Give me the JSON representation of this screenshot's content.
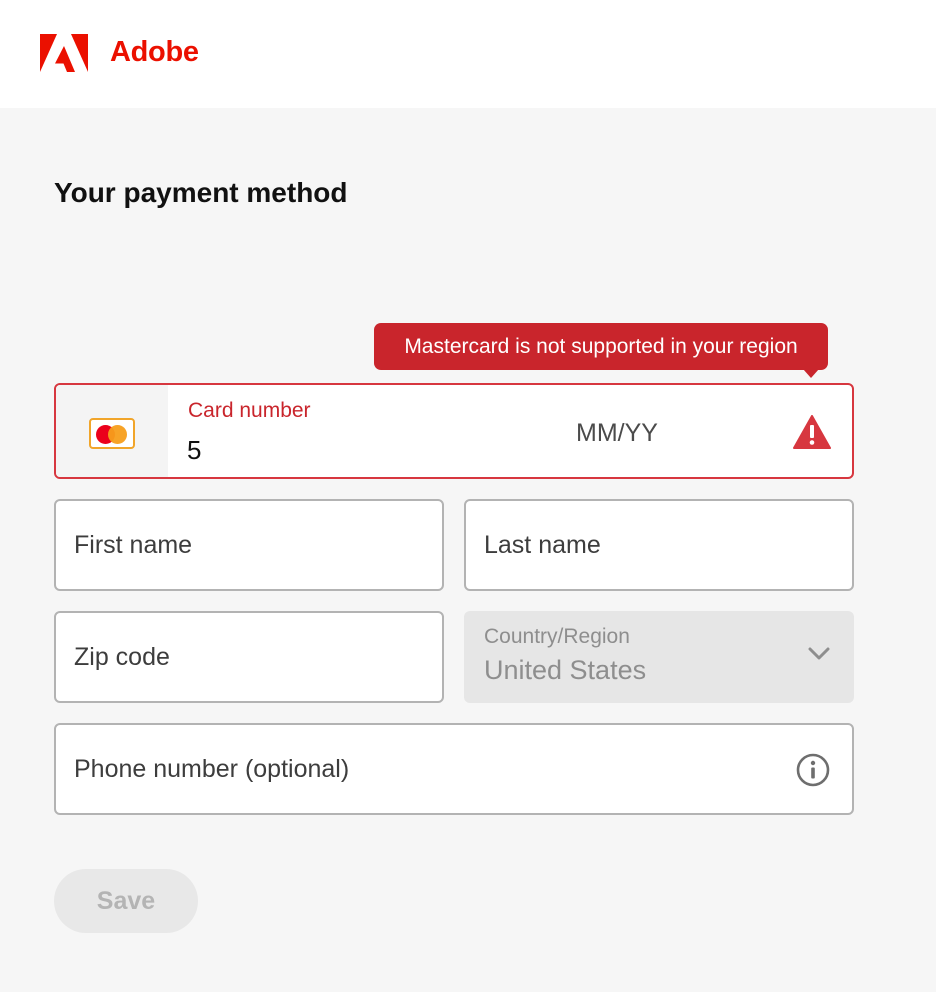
{
  "brand": {
    "name": "Adobe",
    "color": "#eb1000",
    "logo_icon": "adobe-logo-icon"
  },
  "page": {
    "title": "Your payment method"
  },
  "error": {
    "message": "Mastercard is not supported in your region",
    "color": "#c9252c",
    "icon": "alert-triangle-icon"
  },
  "card": {
    "label": "Card number",
    "value": "5",
    "brand_icon": "mastercard-icon",
    "expiry_placeholder": "MM/YY"
  },
  "form": {
    "first_name_placeholder": "First name",
    "last_name_placeholder": "Last name",
    "zip_placeholder": "Zip code",
    "country_label": "Country/Region",
    "country_value": "United States",
    "country_icon": "chevron-down-icon",
    "phone_placeholder": "Phone number (optional)",
    "phone_info_icon": "info-icon"
  },
  "actions": {
    "save_label": "Save"
  }
}
